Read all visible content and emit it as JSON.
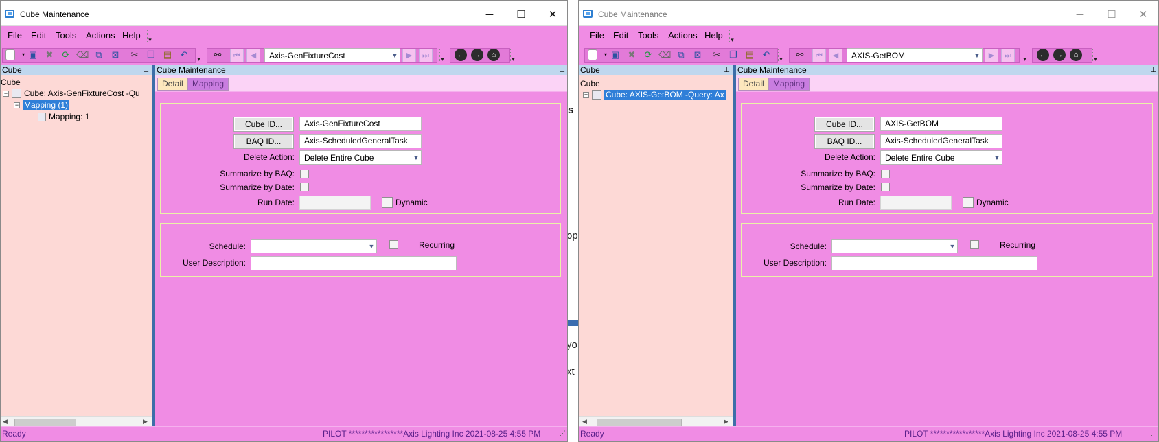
{
  "background_fragments": [
    "s",
    "op",
    "yo",
    "xt"
  ],
  "windows": [
    {
      "title": "Cube Maintenance",
      "active": true,
      "controls": {
        "minimize": "─",
        "maximize": "☐",
        "close": "✕"
      },
      "menu": [
        "File",
        "Edit",
        "Tools",
        "Actions",
        "Help"
      ],
      "toolbar": {
        "key_value": "Axis-GenFixtureCost"
      },
      "left_panel": {
        "header": "Cube",
        "root": "Cube",
        "node_cube": "Cube:  Axis-GenFixtureCost -Qu",
        "node_mapping": "Mapping (1)",
        "node_mapping_child": "Mapping: 1"
      },
      "main_panel": {
        "header": "Cube Maintenance",
        "tabs": [
          "Detail",
          "Mapping"
        ],
        "cube_id_button": "Cube ID...",
        "cube_id_value": "Axis-GenFixtureCost",
        "baq_id_button": "BAQ ID...",
        "baq_id_value": "Axis-ScheduledGeneralTask",
        "delete_action_label": "Delete Action:",
        "delete_action_value": "Delete Entire Cube",
        "summarize_baq_label": "Summarize by BAQ:",
        "summarize_date_label": "Summarize by Date:",
        "run_date_label": "Run Date:",
        "run_date_value": "",
        "dynamic_label": "Dynamic",
        "schedule_label": "Schedule:",
        "schedule_value": "",
        "recurring_label": "Recurring",
        "user_description_label": "User Description:",
        "user_description_value": ""
      },
      "status": {
        "left": "Ready",
        "right": "PILOT *****************Axis Lighting Inc  2021-08-25  4:55 PM"
      }
    },
    {
      "title": "Cube Maintenance",
      "active": false,
      "controls": {
        "minimize": "─",
        "maximize": "☐",
        "close": "✕"
      },
      "menu": [
        "File",
        "Edit",
        "Tools",
        "Actions",
        "Help"
      ],
      "toolbar": {
        "key_value": "AXIS-GetBOM"
      },
      "left_panel": {
        "header": "Cube",
        "root": "Cube",
        "node_cube": "Cube:  AXIS-GetBOM -Query: Ax"
      },
      "main_panel": {
        "header": "Cube Maintenance",
        "tabs": [
          "Detail",
          "Mapping"
        ],
        "cube_id_button": "Cube ID...",
        "cube_id_value": "AXIS-GetBOM",
        "baq_id_button": "BAQ ID...",
        "baq_id_value": "Axis-ScheduledGeneralTask",
        "delete_action_label": "Delete Action:",
        "delete_action_value": "Delete Entire Cube",
        "summarize_baq_label": "Summarize by BAQ:",
        "summarize_date_label": "Summarize by Date:",
        "run_date_label": "Run Date:",
        "run_date_value": "",
        "dynamic_label": "Dynamic",
        "schedule_label": "Schedule:",
        "schedule_value": "",
        "recurring_label": "Recurring",
        "user_description_label": "User Description:",
        "user_description_value": ""
      },
      "status": {
        "left": "Ready",
        "right": "PILOT *****************Axis Lighting Inc  2021-08-25  4:55 PM"
      }
    }
  ],
  "icons": {
    "new": "new-icon",
    "save": "save-icon",
    "delete": "delete-icon",
    "refresh": "refresh-icon",
    "clear": "clear-icon",
    "attach": "attachment-icon",
    "cut": "cut-icon",
    "copy": "copy-icon",
    "paste": "paste-icon",
    "undo": "undo-icon",
    "search": "binoculars-icon",
    "back": "back-icon",
    "forward": "forward-icon",
    "home": "home-icon"
  },
  "colors": {
    "window_background": "#f08ce4",
    "tree_background": "#fdd9d6",
    "selection": "#2f7fd8",
    "splitter": "#3d6ea8",
    "status_text": "#5a1f8a"
  }
}
